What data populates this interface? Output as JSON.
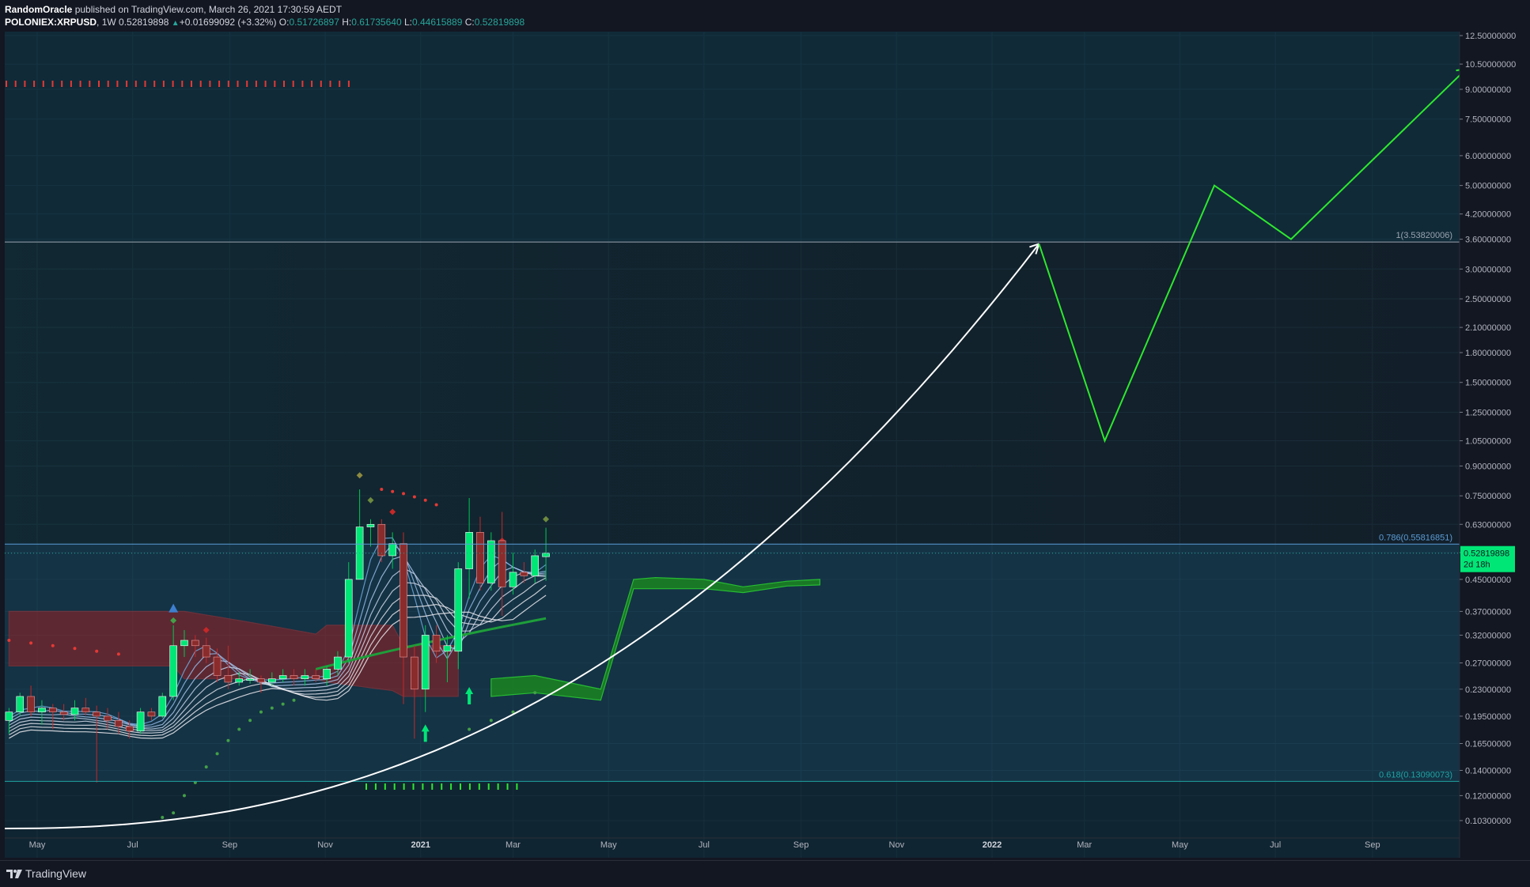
{
  "header": {
    "author": "RandomOracle",
    "published_text": "published on TradingView.com, March 26, 2021 17:30:59 AEDT",
    "symbol": "POLONIEX:XRPUSD",
    "interval": "1W",
    "last": "0.52819898",
    "change": "+0.01699092 (+3.32%)",
    "open_label": "O:",
    "open": "0.51726897",
    "high_label": "H:",
    "high": "0.61735640",
    "low_label": "L:",
    "low": "0.44615889",
    "close_label": "C:",
    "close": "0.52819898"
  },
  "footer": {
    "brand": "TradingView"
  },
  "colors": {
    "background": "#131722",
    "up_candle": "#00e676",
    "down_candle": "#8b2c2c",
    "projection": "#2ee82e",
    "curve": "#ffffff",
    "fib_line": "#5b9bd5",
    "price_tag": "#00e676",
    "red_cloud": "#b71c1c",
    "green_cloud": "#1b8f1b"
  },
  "chart_data": {
    "type": "candlestick",
    "scale": "log",
    "price_axis_ticks": [
      "12.50000000",
      "10.50000000",
      "9.00000000",
      "7.50000000",
      "6.00000000",
      "5.00000000",
      "4.20000000",
      "3.60000000",
      "3.00000000",
      "2.50000000",
      "2.10000000",
      "1.80000000",
      "1.50000000",
      "1.25000000",
      "1.05000000",
      "0.90000000",
      "0.75000000",
      "0.63000000",
      "0.53000000",
      "0.45000000",
      "0.37000000",
      "0.32000000",
      "0.27000000",
      "0.23000000",
      "0.19500000",
      "0.16500000",
      "0.14000000",
      "0.12000000",
      "0.10300000"
    ],
    "time_axis_labels": [
      "May",
      "Jul",
      "Sep",
      "Nov",
      "2021",
      "Mar",
      "May",
      "Jul",
      "Sep",
      "Nov",
      "2022",
      "Mar",
      "May",
      "Jul",
      "Sep"
    ],
    "fib_levels": [
      {
        "label": "1(3.53820006)",
        "value": 3.5382
      },
      {
        "label": "0.786(0.55816851)",
        "value": 0.55816851
      },
      {
        "label": "0.618(0.13090073)",
        "value": 0.13090073
      }
    ],
    "last_price": {
      "value": "0.52819898",
      "countdown": "2d 18h"
    },
    "candles": [
      {
        "date": "2020-04-13",
        "o": 0.19,
        "h": 0.205,
        "l": 0.175,
        "c": 0.2
      },
      {
        "date": "2020-04-20",
        "o": 0.2,
        "h": 0.225,
        "l": 0.195,
        "c": 0.22
      },
      {
        "date": "2020-04-27",
        "o": 0.22,
        "h": 0.235,
        "l": 0.195,
        "c": 0.2
      },
      {
        "date": "2020-05-04",
        "o": 0.2,
        "h": 0.215,
        "l": 0.185,
        "c": 0.205
      },
      {
        "date": "2020-05-11",
        "o": 0.205,
        "h": 0.21,
        "l": 0.18,
        "c": 0.2
      },
      {
        "date": "2020-05-18",
        "o": 0.2,
        "h": 0.21,
        "l": 0.19,
        "c": 0.197
      },
      {
        "date": "2020-05-25",
        "o": 0.197,
        "h": 0.215,
        "l": 0.19,
        "c": 0.205
      },
      {
        "date": "2020-06-01",
        "o": 0.205,
        "h": 0.218,
        "l": 0.196,
        "c": 0.2
      },
      {
        "date": "2020-06-08",
        "o": 0.2,
        "h": 0.208,
        "l": 0.13,
        "c": 0.195
      },
      {
        "date": "2020-06-15",
        "o": 0.195,
        "h": 0.205,
        "l": 0.18,
        "c": 0.19
      },
      {
        "date": "2020-06-22",
        "o": 0.19,
        "h": 0.2,
        "l": 0.175,
        "c": 0.183
      },
      {
        "date": "2020-06-29",
        "o": 0.183,
        "h": 0.19,
        "l": 0.17,
        "c": 0.178
      },
      {
        "date": "2020-07-06",
        "o": 0.178,
        "h": 0.205,
        "l": 0.175,
        "c": 0.2
      },
      {
        "date": "2020-07-13",
        "o": 0.2,
        "h": 0.205,
        "l": 0.19,
        "c": 0.195
      },
      {
        "date": "2020-07-20",
        "o": 0.195,
        "h": 0.225,
        "l": 0.193,
        "c": 0.22
      },
      {
        "date": "2020-07-27",
        "o": 0.22,
        "h": 0.34,
        "l": 0.215,
        "c": 0.3
      },
      {
        "date": "2020-08-03",
        "o": 0.3,
        "h": 0.33,
        "l": 0.28,
        "c": 0.31
      },
      {
        "date": "2020-08-10",
        "o": 0.31,
        "h": 0.32,
        "l": 0.28,
        "c": 0.3
      },
      {
        "date": "2020-08-17",
        "o": 0.3,
        "h": 0.315,
        "l": 0.27,
        "c": 0.28
      },
      {
        "date": "2020-08-24",
        "o": 0.28,
        "h": 0.295,
        "l": 0.24,
        "c": 0.25
      },
      {
        "date": "2020-08-31",
        "o": 0.25,
        "h": 0.3,
        "l": 0.23,
        "c": 0.24
      },
      {
        "date": "2020-09-07",
        "o": 0.24,
        "h": 0.255,
        "l": 0.235,
        "c": 0.245
      },
      {
        "date": "2020-09-14",
        "o": 0.245,
        "h": 0.26,
        "l": 0.238,
        "c": 0.245
      },
      {
        "date": "2020-09-21",
        "o": 0.245,
        "h": 0.25,
        "l": 0.225,
        "c": 0.24
      },
      {
        "date": "2020-09-28",
        "o": 0.24,
        "h": 0.255,
        "l": 0.235,
        "c": 0.245
      },
      {
        "date": "2020-10-05",
        "o": 0.245,
        "h": 0.26,
        "l": 0.24,
        "c": 0.25
      },
      {
        "date": "2020-10-12",
        "o": 0.25,
        "h": 0.26,
        "l": 0.235,
        "c": 0.245
      },
      {
        "date": "2020-10-19",
        "o": 0.245,
        "h": 0.26,
        "l": 0.235,
        "c": 0.25
      },
      {
        "date": "2020-10-26",
        "o": 0.25,
        "h": 0.26,
        "l": 0.24,
        "c": 0.245
      },
      {
        "date": "2020-11-02",
        "o": 0.245,
        "h": 0.265,
        "l": 0.235,
        "c": 0.26
      },
      {
        "date": "2020-11-09",
        "o": 0.26,
        "h": 0.29,
        "l": 0.25,
        "c": 0.28
      },
      {
        "date": "2020-11-16",
        "o": 0.28,
        "h": 0.5,
        "l": 0.27,
        "c": 0.45
      },
      {
        "date": "2020-11-23",
        "o": 0.45,
        "h": 0.78,
        "l": 0.45,
        "c": 0.62
      },
      {
        "date": "2020-11-30",
        "o": 0.62,
        "h": 0.65,
        "l": 0.55,
        "c": 0.63
      },
      {
        "date": "2020-12-07",
        "o": 0.63,
        "h": 0.65,
        "l": 0.5,
        "c": 0.52
      },
      {
        "date": "2020-12-14",
        "o": 0.52,
        "h": 0.6,
        "l": 0.48,
        "c": 0.56
      },
      {
        "date": "2020-12-21",
        "o": 0.56,
        "h": 0.6,
        "l": 0.21,
        "c": 0.28
      },
      {
        "date": "2020-12-28",
        "o": 0.28,
        "h": 0.3,
        "l": 0.17,
        "c": 0.23
      },
      {
        "date": "2021-01-04",
        "o": 0.23,
        "h": 0.34,
        "l": 0.2,
        "c": 0.32
      },
      {
        "date": "2021-01-11",
        "o": 0.32,
        "h": 0.34,
        "l": 0.27,
        "c": 0.29
      },
      {
        "date": "2021-01-18",
        "o": 0.29,
        "h": 0.32,
        "l": 0.24,
        "c": 0.3
      },
      {
        "date": "2021-01-25",
        "o": 0.29,
        "h": 0.5,
        "l": 0.26,
        "c": 0.48
      },
      {
        "date": "2021-02-01",
        "o": 0.48,
        "h": 0.74,
        "l": 0.4,
        "c": 0.6
      },
      {
        "date": "2021-02-08",
        "o": 0.6,
        "h": 0.66,
        "l": 0.42,
        "c": 0.44
      },
      {
        "date": "2021-02-15",
        "o": 0.44,
        "h": 0.6,
        "l": 0.42,
        "c": 0.57
      },
      {
        "date": "2021-02-22",
        "o": 0.57,
        "h": 0.68,
        "l": 0.36,
        "c": 0.43
      },
      {
        "date": "2021-03-01",
        "o": 0.43,
        "h": 0.53,
        "l": 0.41,
        "c": 0.47
      },
      {
        "date": "2021-03-08",
        "o": 0.47,
        "h": 0.5,
        "l": 0.44,
        "c": 0.46
      },
      {
        "date": "2021-03-15",
        "o": 0.46,
        "h": 0.54,
        "l": 0.44,
        "c": 0.52
      },
      {
        "date": "2021-03-22",
        "o": 0.517,
        "h": 0.617,
        "l": 0.446,
        "c": 0.528
      }
    ],
    "curve_endpoint": {
      "date": "2022-01-31",
      "value": 3.5
    },
    "projection_path": [
      {
        "date": "2022-01-31",
        "value": 3.5
      },
      {
        "date": "2022-03-14",
        "value": 1.05
      },
      {
        "date": "2022-05-23",
        "value": 5.0
      },
      {
        "date": "2022-07-11",
        "value": 3.6
      },
      {
        "date": "2022-10-31",
        "value": 10.2
      }
    ]
  }
}
